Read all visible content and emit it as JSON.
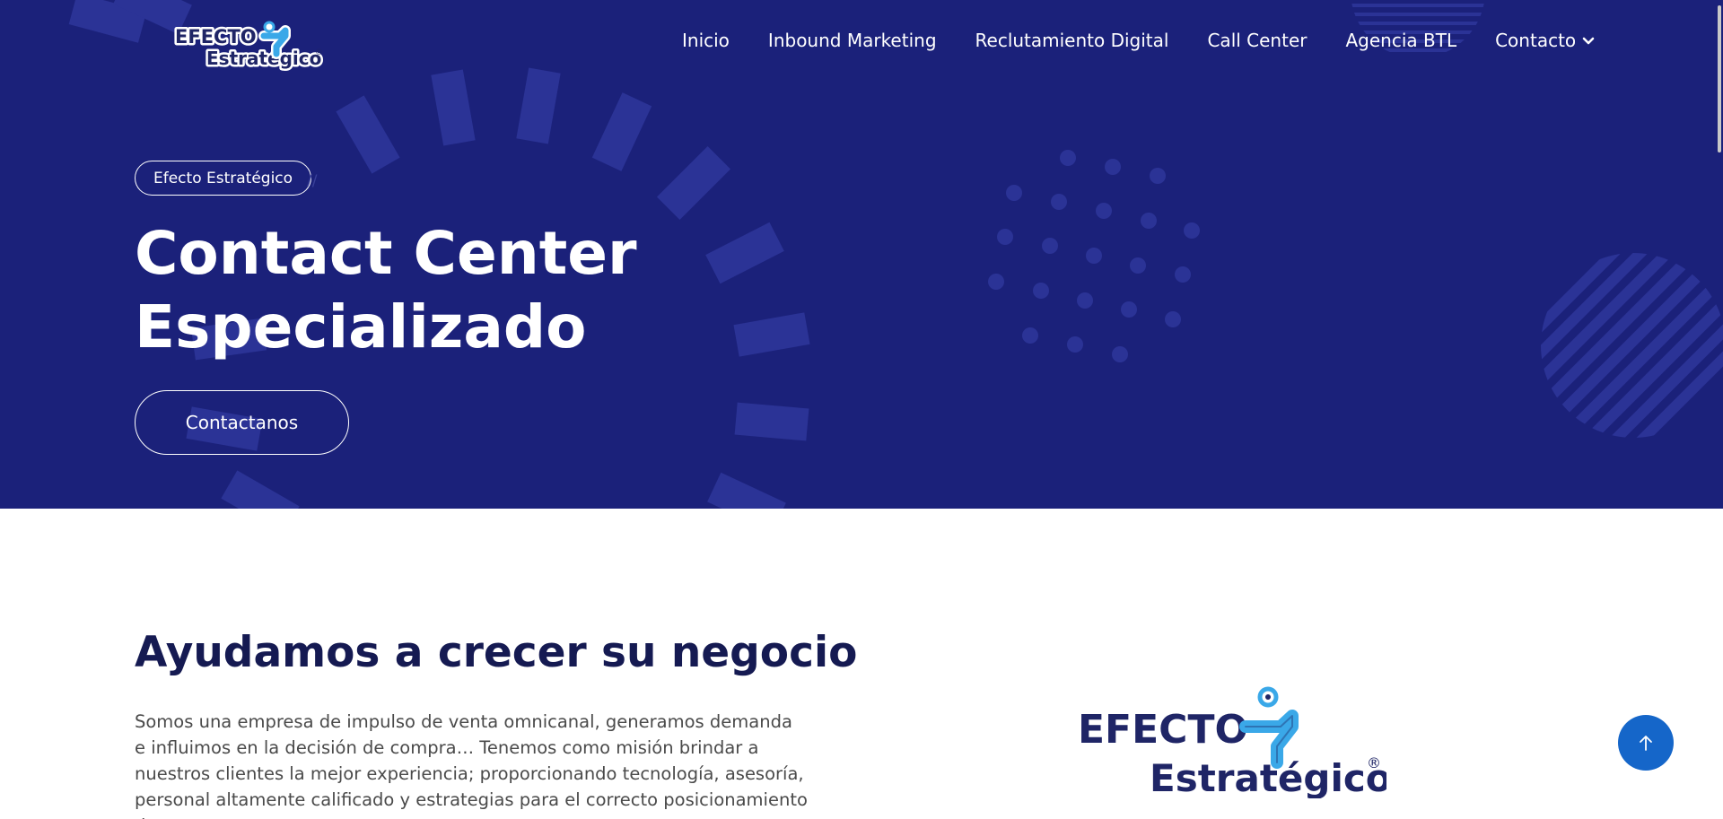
{
  "brand": {
    "logo_line1": "EFECTO",
    "logo_line2": "Estratégico",
    "registered": "®"
  },
  "nav": {
    "items": [
      {
        "label": "Inicio"
      },
      {
        "label": "Inbound Marketing"
      },
      {
        "label": "Reclutamiento Digital"
      },
      {
        "label": "Call Center"
      },
      {
        "label": "Agencia BTL"
      },
      {
        "label": "Contacto"
      }
    ]
  },
  "hero": {
    "tag": "Efecto Estratégico",
    "tag_separator": "//",
    "title_line1": "Contact Center",
    "title_line2": "Especializado",
    "cta_label": "Contactanos"
  },
  "about": {
    "title": "Ayudamos a crecer su negocio",
    "text": "Somos una empresa de impulso de venta omnicanal, generamos demanda e influimos en la decisión de compra… Tenemos como misión brindar a nuestros clientes la mejor experiencia; proporcionando tecnología, asesoría, personal altamente calificado y estrategias para el correcto posicionamiento de nuestras"
  },
  "colors": {
    "hero_bg": "#1b217a",
    "deco": "#2b3396",
    "heading_dark": "#151a52",
    "logo_navy": "#1f2566",
    "logo_blue": "#3aa8e8",
    "scrolltop_bg": "#1566c9"
  },
  "icons": {
    "dropdown": "chevron-down-icon",
    "scroll_top": "arrow-up-icon"
  }
}
